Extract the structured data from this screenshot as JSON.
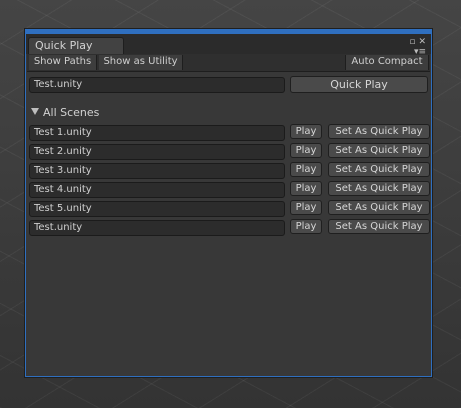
{
  "window": {
    "tab_title": "Quick Play",
    "restore_icon": "▫",
    "close_icon": "✕",
    "menu_icon": "▾≡"
  },
  "toolbar": {
    "show_paths": "Show Paths",
    "show_as_utility": "Show as Utility",
    "auto_compact": "Auto Compact"
  },
  "current_scene": {
    "value": "Test.unity",
    "button": "Quick Play"
  },
  "all_scenes": {
    "label": "All Scenes",
    "rows": [
      {
        "name": "Test 1.unity",
        "play": "Play",
        "set": "Set As Quick Play"
      },
      {
        "name": "Test 2.unity",
        "play": "Play",
        "set": "Set As Quick Play"
      },
      {
        "name": "Test 3.unity",
        "play": "Play",
        "set": "Set As Quick Play"
      },
      {
        "name": "Test 4.unity",
        "play": "Play",
        "set": "Set As Quick Play"
      },
      {
        "name": "Test 5.unity",
        "play": "Play",
        "set": "Set As Quick Play"
      },
      {
        "name": "Test.unity",
        "play": "Play",
        "set": "Set As Quick Play"
      }
    ]
  },
  "colors": {
    "accent": "#2f6fbf",
    "panel": "#383838",
    "field": "#2c2c2c"
  }
}
